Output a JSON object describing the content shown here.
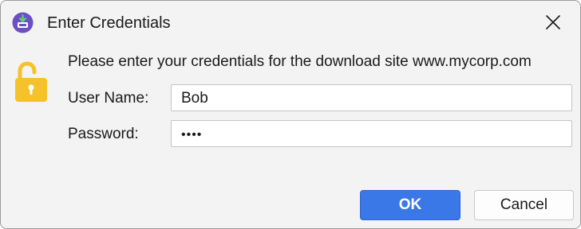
{
  "window": {
    "title": "Enter Credentials",
    "app_icon": "download-app-icon",
    "close_icon": "close-icon"
  },
  "content": {
    "lock_icon": "unlocked-padlock-icon",
    "message": "Please enter your credentials for the download site www.mycorp.com"
  },
  "form": {
    "username_label": "User Name:",
    "username_value": "Bob",
    "password_label": "Password:",
    "password_masked": "••••"
  },
  "buttons": {
    "ok_label": "OK",
    "cancel_label": "Cancel"
  },
  "colors": {
    "accent": "#3b78e7",
    "lock": "#f5c22b",
    "app_icon": "#6b4fc4"
  }
}
